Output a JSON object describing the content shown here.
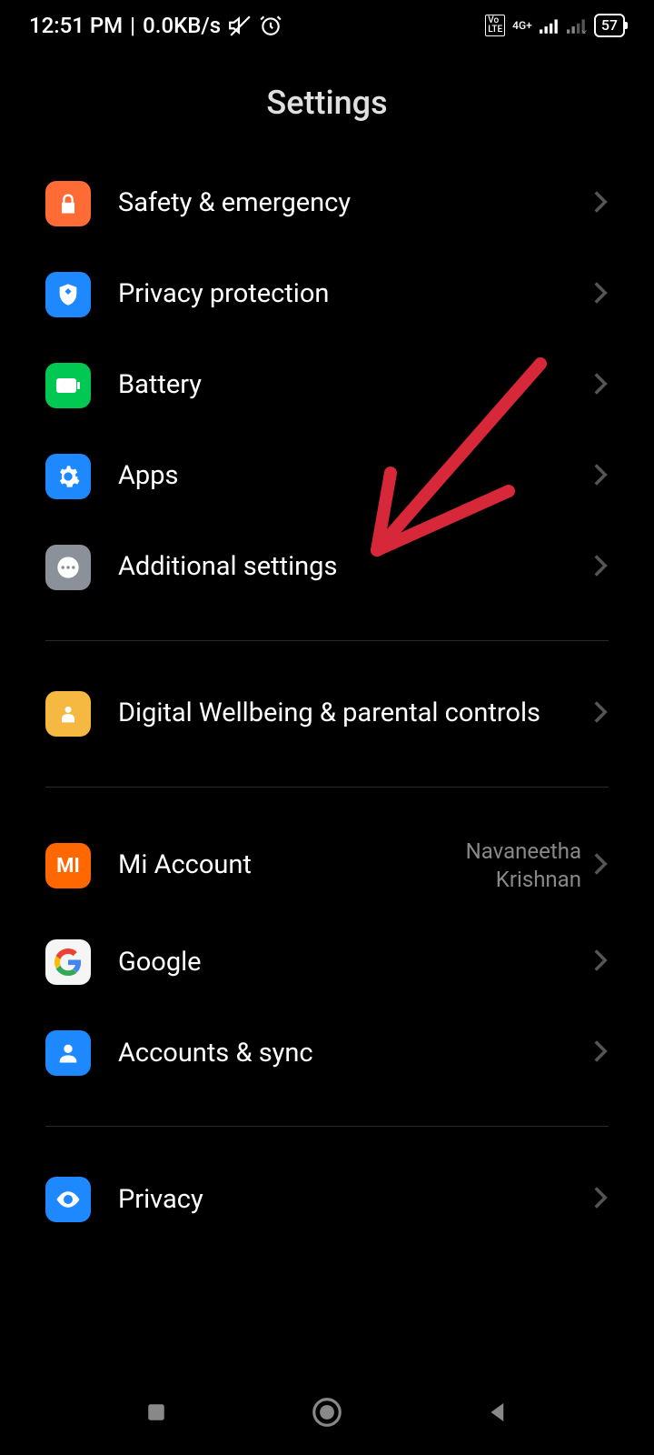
{
  "status": {
    "time": "12:51 PM",
    "dataRate": "0.0KB/s",
    "network": "4G+",
    "battery": "57"
  },
  "title": "Settings",
  "sections": [
    {
      "items": [
        {
          "id": "safety",
          "label": "Safety & emergency"
        },
        {
          "id": "privacy-protection",
          "label": "Privacy protection"
        },
        {
          "id": "battery",
          "label": "Battery"
        },
        {
          "id": "apps",
          "label": "Apps"
        },
        {
          "id": "additional",
          "label": "Additional settings"
        }
      ]
    },
    {
      "items": [
        {
          "id": "wellbeing",
          "label": "Digital Wellbeing & parental controls"
        }
      ]
    },
    {
      "items": [
        {
          "id": "mi-account",
          "label": "Mi Account",
          "value": "Navaneetha\nKrishnan"
        },
        {
          "id": "google",
          "label": "Google"
        },
        {
          "id": "accounts-sync",
          "label": "Accounts & sync"
        }
      ]
    },
    {
      "items": [
        {
          "id": "privacy",
          "label": "Privacy"
        }
      ]
    }
  ]
}
